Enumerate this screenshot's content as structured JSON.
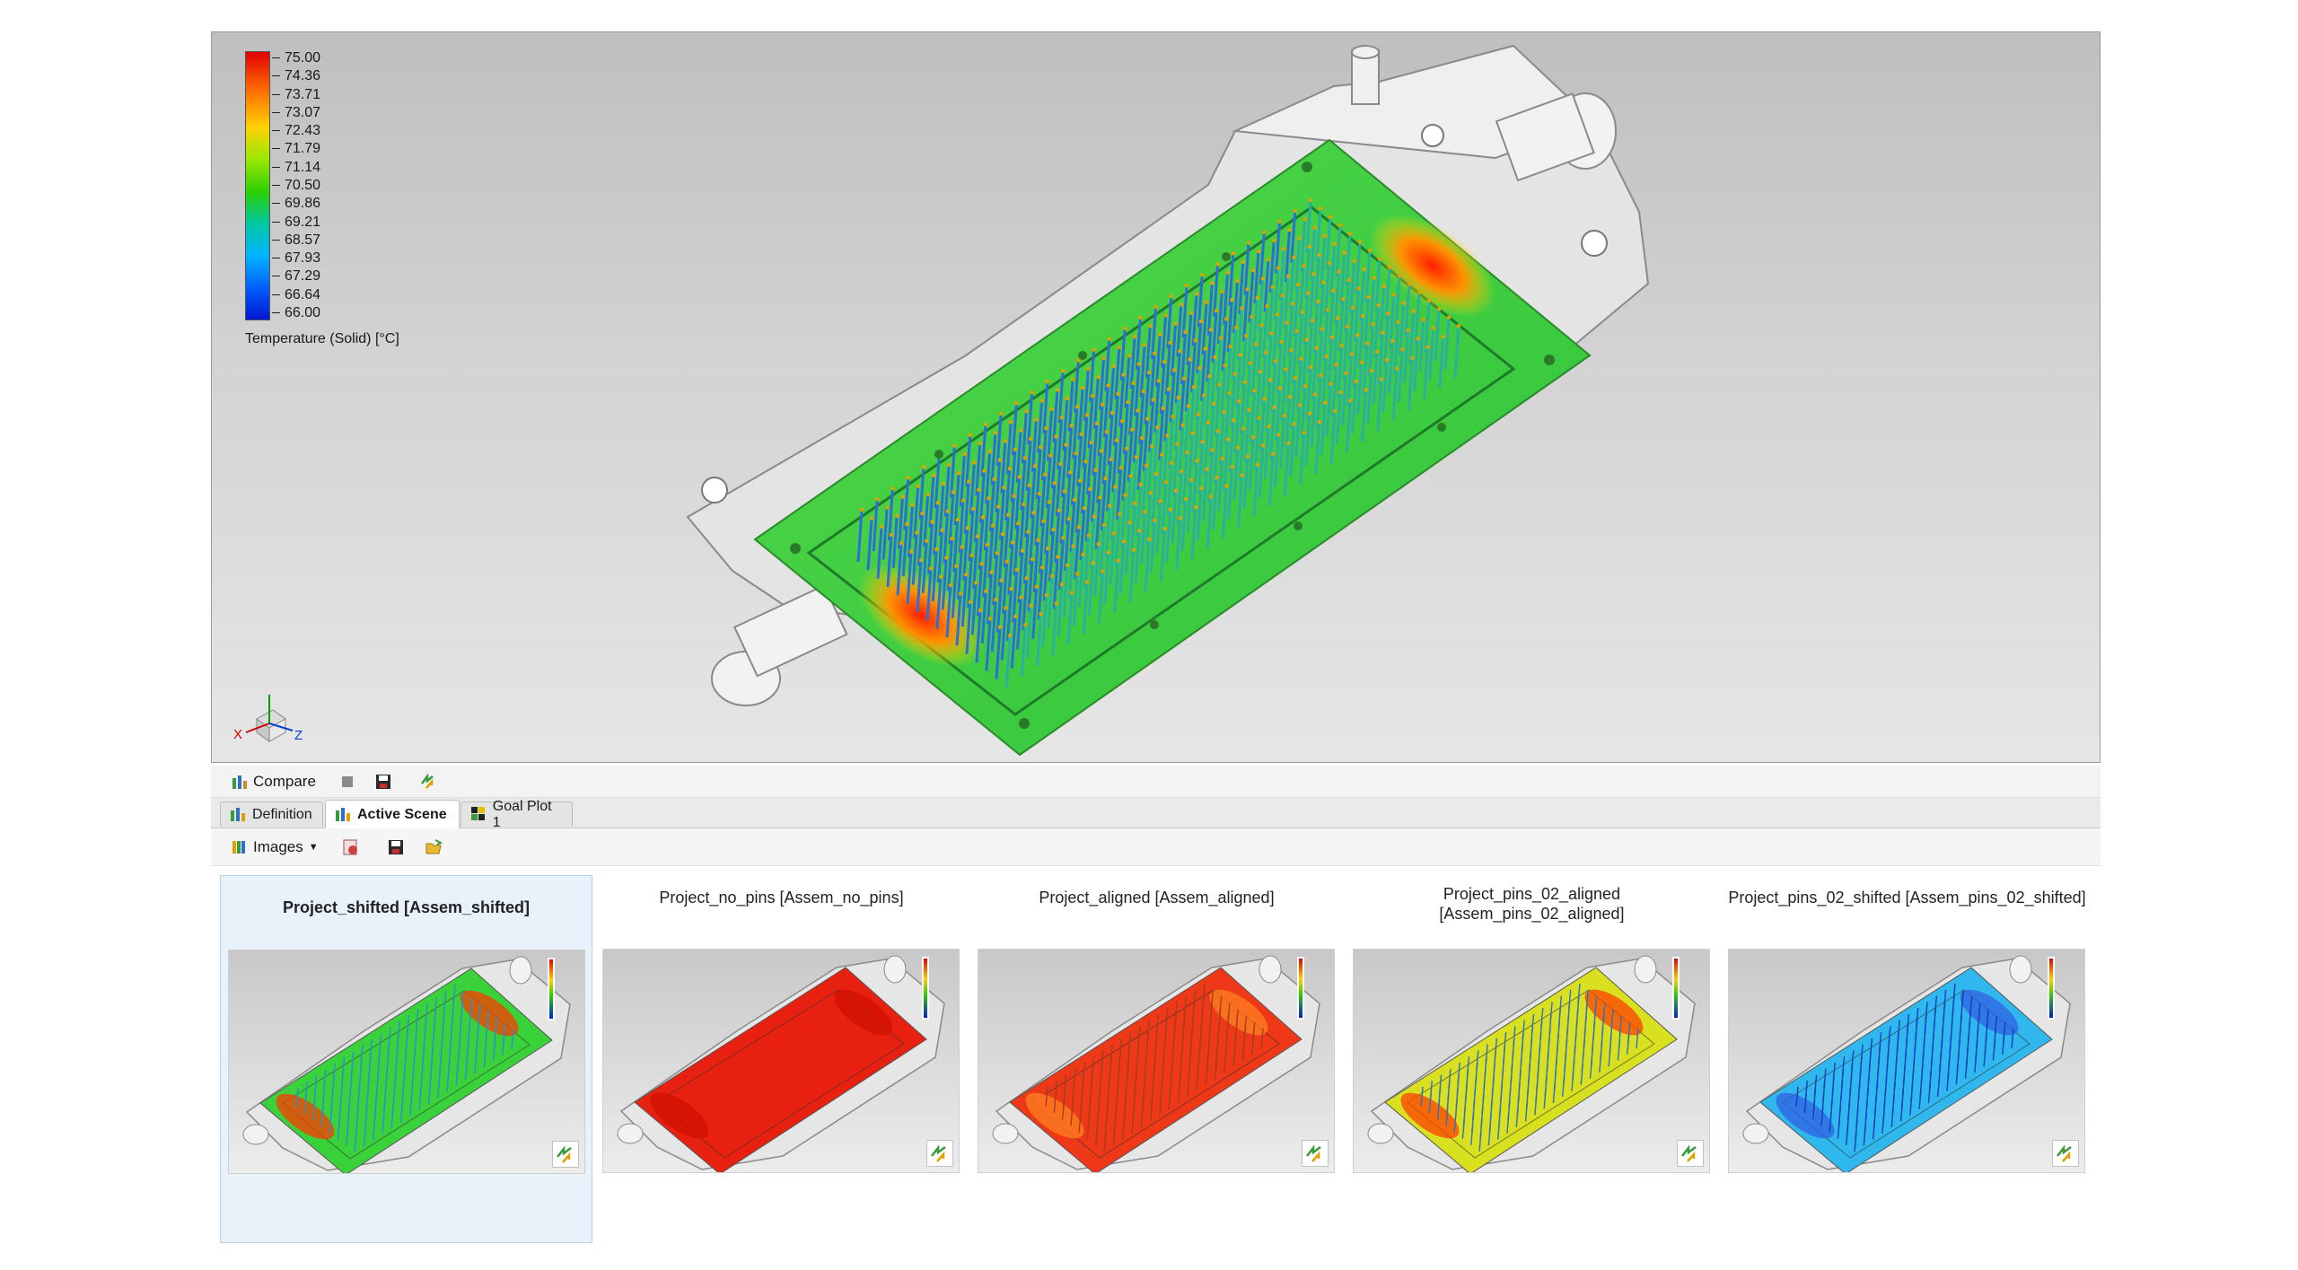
{
  "legend": {
    "title": "Temperature (Solid) [°C]",
    "ticks": [
      "75.00",
      "74.36",
      "73.71",
      "73.07",
      "72.43",
      "71.79",
      "71.14",
      "70.50",
      "69.86",
      "69.21",
      "68.57",
      "67.93",
      "67.29",
      "66.64",
      "66.00"
    ]
  },
  "triad": {
    "x_label": "X",
    "z_label": "Z"
  },
  "toolbar": {
    "compare_label": "Compare"
  },
  "tabs": [
    {
      "label": "Definition"
    },
    {
      "label": "Active Scene"
    },
    {
      "label": "Goal Plot 1"
    }
  ],
  "images_toolbar": {
    "images_label": "Images"
  },
  "thumbnails": [
    {
      "title": "Project_shifted [Assem_shifted]",
      "plate_color": "#3ad23a",
      "pin_color": "#2d8fd0",
      "hot_color": "#ff3a00"
    },
    {
      "title": "Project_no_pins [Assem_no_pins]",
      "plate_color": "#e82010",
      "pin_color": "#e82010",
      "hot_color": "#d01000"
    },
    {
      "title": "Project_aligned [Assem_aligned]",
      "plate_color": "#ee3818",
      "pin_color": "#a04020",
      "hot_color": "#ff8020"
    },
    {
      "title": "Project_pins_02_aligned\n[Assem_pins_02_aligned]",
      "plate_color": "#d8e020",
      "pin_color": "#3070c0",
      "hot_color": "#ff4000"
    },
    {
      "title": "Project_pins_02_shifted [Assem_pins_02_shifted]",
      "plate_color": "#30b8ee",
      "pin_color": "#1040c0",
      "hot_color": "#3060e0"
    }
  ],
  "colors": {
    "accent": "#2ed000",
    "selection": "#e9f1fb"
  }
}
